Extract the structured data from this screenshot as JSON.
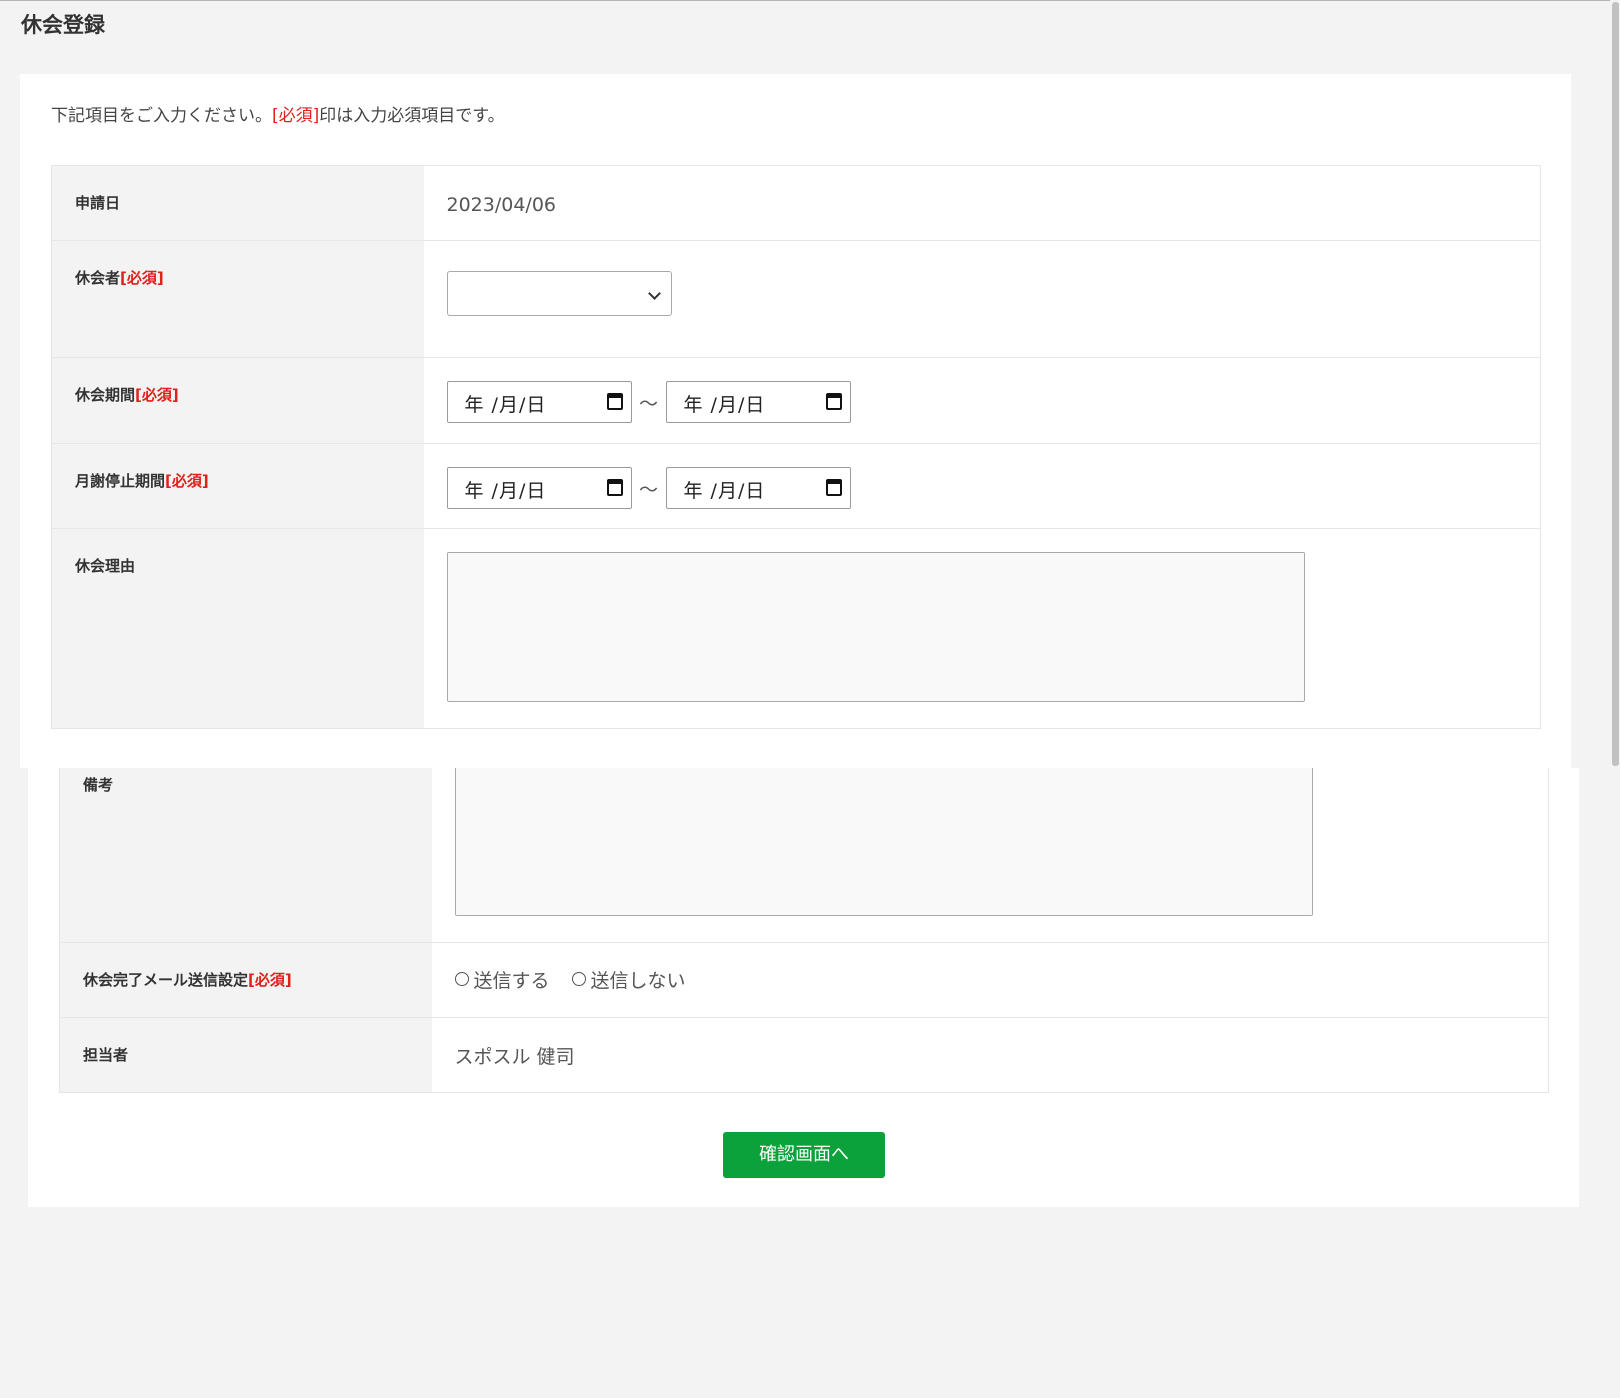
{
  "page": {
    "title": "休会登録"
  },
  "intro": {
    "before": "下記項目をご入力ください。",
    "required_mark": "[必須]",
    "after": "印は入力必須項目です。"
  },
  "required_label": "[必須]",
  "fields": {
    "application_date": {
      "label": "申請日",
      "value": "2023/04/06"
    },
    "member": {
      "label": "休会者",
      "selected": ""
    },
    "leave_period": {
      "label": "休会期間",
      "from_placeholder": "年 /月/日",
      "to_placeholder": "年 /月/日",
      "separator": "〜"
    },
    "fee_stop_period": {
      "label": "月謝停止期間",
      "from_placeholder": "年 /月/日",
      "to_placeholder": "年 /月/日",
      "separator": "〜"
    },
    "reason": {
      "label": "休会理由",
      "value": ""
    },
    "remarks": {
      "label": "備考",
      "value": ""
    },
    "mail_setting": {
      "label": "休会完了メール送信設定",
      "options": [
        "送信する",
        "送信しない"
      ]
    },
    "staff": {
      "label": "担当者",
      "value": "スポスル 健司"
    }
  },
  "actions": {
    "confirm_label": "確認画面へ"
  },
  "colors": {
    "required": "#e0201b",
    "confirm_button": "#0ba23c",
    "label_background": "#f3f3f3"
  }
}
